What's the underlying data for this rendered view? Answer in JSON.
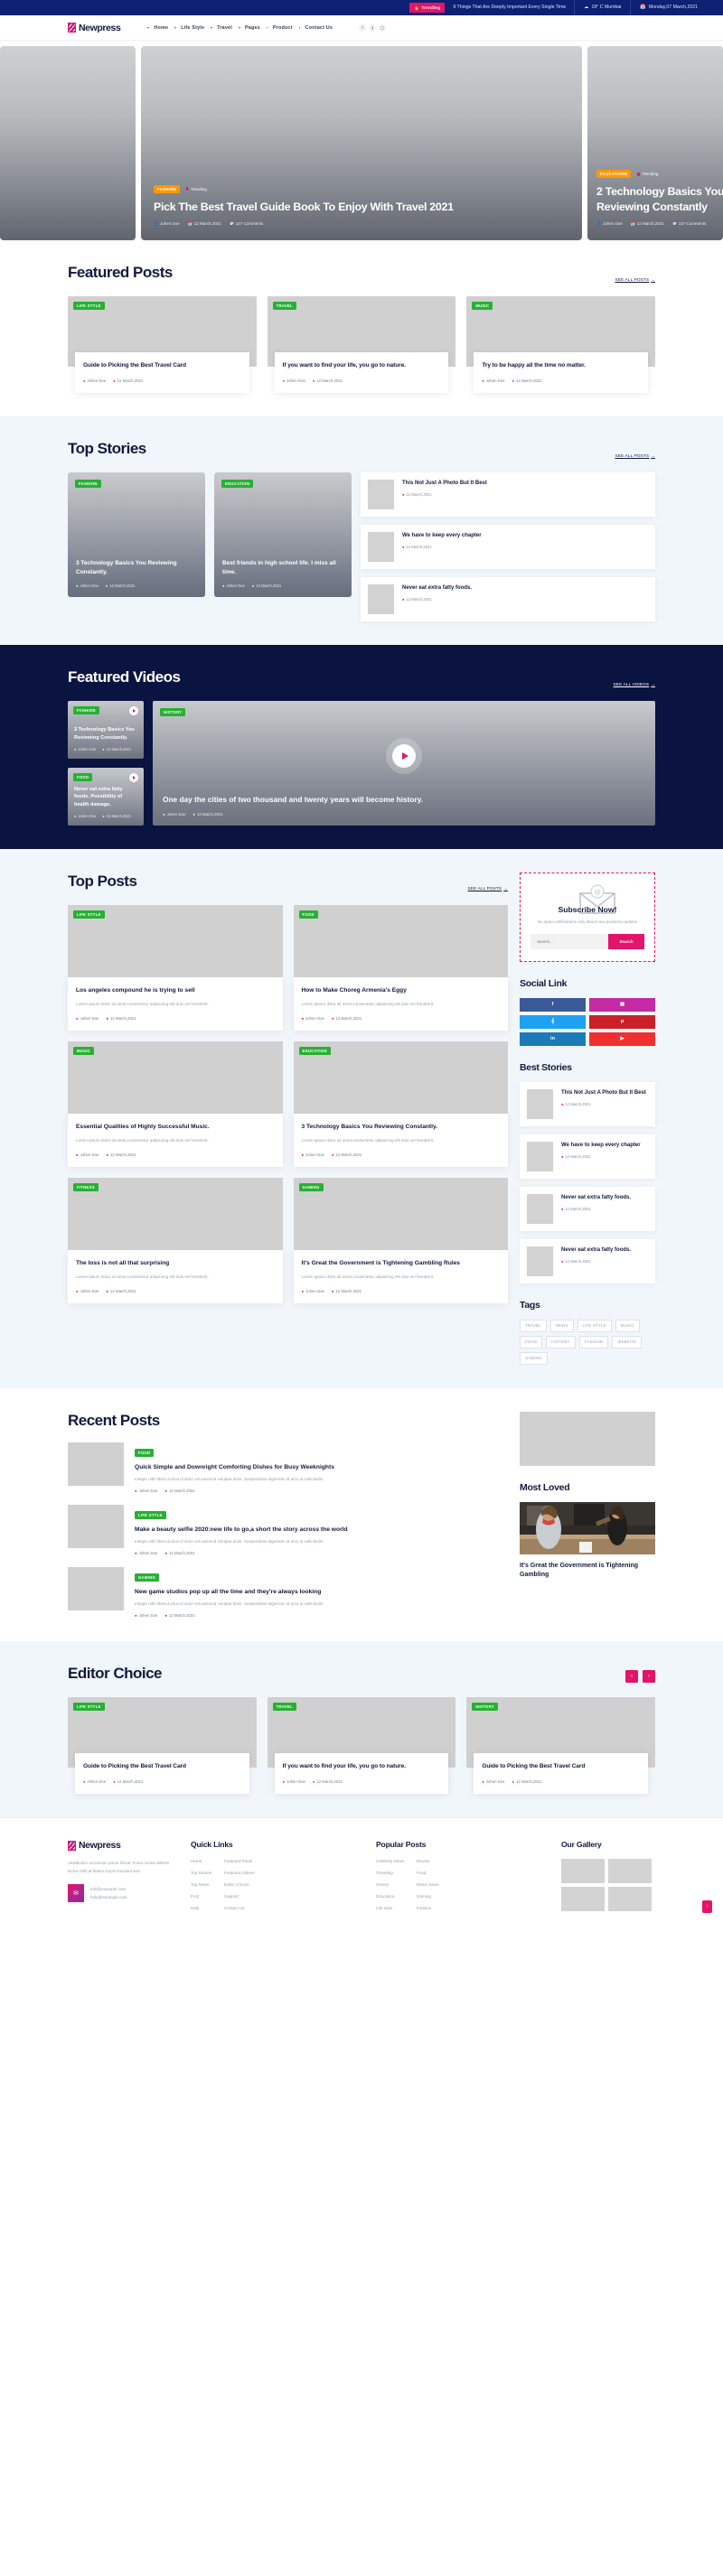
{
  "topbar": {
    "trending_label": "Trending",
    "trending_icon": "fire-icon",
    "headline": "9 Things That Are Deeply Important Every Single Time",
    "weather": "19° C Mumbai",
    "date": "Monday,07 March,2021"
  },
  "header": {
    "brand": "Newpress",
    "nav": [
      "Home",
      "Life Style",
      "Travel",
      "Pages",
      "Product",
      "Contact Us"
    ],
    "social": [
      "facebook-icon",
      "twitter-icon",
      "instagram-icon"
    ]
  },
  "hero": {
    "slides": [
      {
        "category": "FASHION",
        "trending": "Trending",
        "title": "Pick The Best Travel Guide Book To Enjoy With Travel 2021",
        "author": "Johen Doe",
        "date": "12 March,2021",
        "comments": "147 Comments"
      },
      {
        "category": "EDUCATIONS",
        "trending": "Trending",
        "title": "2 Technology Basics You Reviewing Constantly",
        "author": "Johen Doe",
        "date": "12 March,2021",
        "comments": "147 Comments"
      }
    ]
  },
  "featured_posts": {
    "title": "Featured Posts",
    "see_all": "SEE ALL POSTS",
    "cards": [
      {
        "category": "LIFE STYLE",
        "title": "Guide to Picking the Best Travel Card",
        "author": "Johen Doe",
        "date": "12 March,2021"
      },
      {
        "category": "TRAVEL",
        "title": "If you want to find your life, you go to nature.",
        "author": "Johen Doe",
        "date": "12 March,2021"
      },
      {
        "category": "MUSIC",
        "title": "Try to be happy all the time no matter.",
        "author": "Johen Doe",
        "date": "12 March,2021"
      }
    ]
  },
  "top_stories": {
    "title": "Top Stories",
    "see_all": "SEE ALL POSTS",
    "big": [
      {
        "category": "FASHION",
        "title": "3 Technology Basics You Reviewing Constantly.",
        "author": "Johen Doe",
        "date": "12 March,2021"
      },
      {
        "category": "EDUCATION",
        "title": "Best friends in high school life. I miss all time.",
        "author": "Johen Doe",
        "date": "12 March,2021"
      }
    ],
    "list": [
      {
        "title": "This Not Just A Photo But It Best",
        "date": "12 March,2021"
      },
      {
        "title": "We have to keep every chapter",
        "date": "12 March,2021"
      },
      {
        "title": "Never eat extra fatty foods.",
        "date": "12 March,2021"
      }
    ]
  },
  "featured_videos": {
    "title": "Featured Videos",
    "see_all": "SEE ALL VIDEOS",
    "small": [
      {
        "category": "FASHION",
        "title": "3 Technology Basics You Reviewing Constantly.",
        "author": "Johen Doe",
        "date": "12 March,2021"
      },
      {
        "category": "FOOD",
        "title": "Never eat extra fatty foods. Possibility of health damage.",
        "author": "Johen Doe",
        "date": "12 March,2021"
      }
    ],
    "big": {
      "category": "HISTORY",
      "title": "One day the cities of two thousand and twenty years will become history.",
      "author": "Johen Doe",
      "date": "12 March,2021"
    }
  },
  "top_posts": {
    "title": "Top Posts",
    "see_all": "SEE ALL POSTS",
    "cards": [
      {
        "category": "LIFE STYLE",
        "title": "Los angeles compound he is trying to sell",
        "text": "Lorem ipsum dolor sit amet,consectetur adipiscing elit duis vel hendrerit.",
        "author": "Johen Doe",
        "date": "12 March,2021"
      },
      {
        "category": "FOOD",
        "title": "How to Make Choreg Armenia's Eggy",
        "text": "Lorem ipsum dolor sit amet,consectetur adipiscing elit duis vel hendrerit.",
        "author": "Johen Doe",
        "date": "12 March,2021"
      },
      {
        "category": "MUSIC",
        "title": "Essential Qualities of Highly Successful Music.",
        "text": "Lorem ipsum dolor sit amet,consectetur adipiscing elit duis vel hendrerit.",
        "author": "Johen Doe",
        "date": "12 March,2021"
      },
      {
        "category": "EDUCATION",
        "title": "3 Technology Basics You Reviewing Constantly.",
        "text": "Lorem ipsum dolor sit amet,consectetur adipiscing elit duis vel hendrerit.",
        "author": "Johen Doe",
        "date": "12 March,2021"
      },
      {
        "category": "FITNESS",
        "title": "The loss is not all that surprising",
        "text": "Lorem ipsum dolor sit amet,consectetur adipiscing elit duis vel hendrerit.",
        "author": "Johen Doe",
        "date": "12 March,2021"
      },
      {
        "category": "GAMING",
        "title": "It's Great the Government is Tightening Gambling Rules",
        "text": "Lorem ipsum dolor sit amet,consectetur adipiscing elit duis vel hendrerit.",
        "author": "Johen Doe",
        "date": "12 March,2021"
      }
    ]
  },
  "sidebar": {
    "subscribe": {
      "icon": "envelope-icon",
      "title": "Subscribe Now!",
      "desc": "No spam,notifications only about new products,updates",
      "input_placeholder": "Search...",
      "button": "Search"
    },
    "social_link": {
      "title": "Social Link",
      "buttons": [
        {
          "name": "facebook",
          "glyph": "f",
          "color": "#3b5998"
        },
        {
          "name": "instagram",
          "glyph": "▣",
          "color": "#c32aa3"
        },
        {
          "name": "twitter",
          "glyph": "ᵛ",
          "color": "#1da1f2"
        },
        {
          "name": "pinterest",
          "glyph": "p",
          "color": "#cb2027"
        },
        {
          "name": "linkedin",
          "glyph": "in",
          "color": "#1b7bb9"
        },
        {
          "name": "youtube",
          "glyph": "▶",
          "color": "#f22f2f"
        }
      ]
    },
    "best_stories": {
      "title": "Best Stories",
      "items": [
        {
          "title": "This Not Just A Photo But It Best",
          "date": "12 March,2021"
        },
        {
          "title": "We have to keep every chapter",
          "date": "12 March,2021"
        },
        {
          "title": "Never eat extra fatty foods.",
          "date": "12 March,2021"
        },
        {
          "title": "Never eat extra fatty foods.",
          "date": "12 March,2021"
        }
      ]
    },
    "tags": {
      "title": "Tags",
      "items": [
        "TRAVEL",
        "NEWS",
        "LIFE STYLE",
        "MUSIC",
        "FOOD",
        "HISTORY",
        "FASHION",
        "WEBSITE",
        "GAMING"
      ]
    }
  },
  "recent_posts": {
    "title": "Recent Posts",
    "items": [
      {
        "category": "FOOD",
        "title": "Quick Simple and Downright Comforting Dishes for Busy Weeknights",
        "text": "Integer nibh libero,luctus id dolor vel,euismod volutpat dolor. Suspendisse dignissim id arcu ut sollicitudin.",
        "author": "Johen Doe",
        "date": "12 March,2021"
      },
      {
        "category": "LIFE STYLE",
        "title": "Make a beauty selfie 2020:new life to go,a short the story across the world",
        "text": "Integer nibh libero,luctus id dolor vel,euismod volutpat dolor. Suspendisse dignissim id arcu ut sollicitudin.",
        "author": "Johen Doe",
        "date": "12 March,2021"
      },
      {
        "category": "GAMING",
        "title": "New game studios pop up all the time and they're always looking",
        "text": "Integer nibh libero,luctus id dolor vel,euismod volutpat dolor. Suspendisse dignissim id arcu ut sollicitudin.",
        "author": "Johen Doe",
        "date": "12 March,2021"
      }
    ],
    "most_loved": {
      "title": "Most Loved",
      "caption": "It's Great the Government is Tightening Gambling"
    }
  },
  "editor_choice": {
    "title": "Editor Choice",
    "prev_icon": "chevron-left-icon",
    "next_icon": "chevron-right-icon",
    "cards": [
      {
        "category": "LIFE STYLE",
        "title": "Guide to Picking the Best Travel Card",
        "author": "Johen Doe",
        "date": "12 March,2021"
      },
      {
        "category": "TRAVEL",
        "title": "If you want to find your life, you go to nature.",
        "author": "Johen Doe",
        "date": "12 March,2021"
      },
      {
        "category": "HISTORY",
        "title": "Guide to Picking the Best Travel Card",
        "author": "Johen Doe",
        "date": "12 March,2021"
      }
    ]
  },
  "footer": {
    "brand": "Newpress",
    "about": "Vestibulum accumsan purus felisal. Fusce luctus deferst luctus nibh,at finibus turpis tincidunt sed.",
    "emails": [
      "info@example.com",
      "help@example.com"
    ],
    "quick_links": {
      "title": "Quick Links",
      "col1": [
        "Home",
        "Top Stories",
        "Top News",
        "FAQ",
        "Help"
      ],
      "col2": [
        "Featured Posts",
        "Featured Videos",
        "Editor Choice",
        "Support",
        "Contact Us"
      ]
    },
    "popular_posts": {
      "title": "Popular Posts",
      "col1": [
        "Celebrity News",
        "Traveling",
        "History",
        "Education",
        "Life style"
      ],
      "col2": [
        "Movies",
        "Food",
        "Music News",
        "Gaming",
        "Fashion"
      ]
    },
    "gallery": {
      "title": "Our Gallery",
      "cells": 4
    },
    "to_top_icon": "chevron-up-icon"
  }
}
